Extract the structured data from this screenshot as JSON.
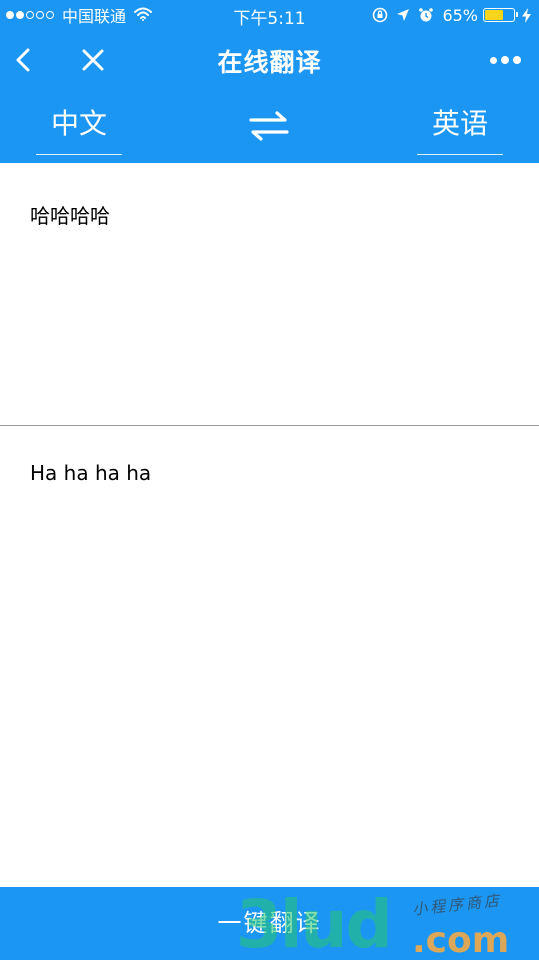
{
  "status_bar": {
    "carrier": "中国联通",
    "time": "下午5:11",
    "battery_percent": "65%",
    "battery_level": 0.65,
    "signal_dots_filled": 2,
    "signal_dots_total": 5,
    "icons": [
      "wifi-icon",
      "rotation-lock-icon",
      "location-icon",
      "alarm-icon",
      "battery-icon",
      "charging-icon"
    ]
  },
  "nav": {
    "title": "在线翻译",
    "icons": [
      "back-icon",
      "close-icon",
      "more-icon"
    ]
  },
  "languages": {
    "source": "中文",
    "target": "英语",
    "swap_icon": "swap-arrows-icon"
  },
  "input": {
    "text": "哈哈哈哈"
  },
  "output": {
    "text": "Ha ha ha ha"
  },
  "actions": {
    "translate_label": "一键翻译"
  },
  "watermark": {
    "logo": "3lud",
    "domain": ".com",
    "tagline": "小程序商店"
  },
  "colors": {
    "primary": "#1c96f3",
    "text_on_primary": "#ffffff",
    "divider": "#9b9b9b",
    "battery_fill": "#f7d51d"
  }
}
